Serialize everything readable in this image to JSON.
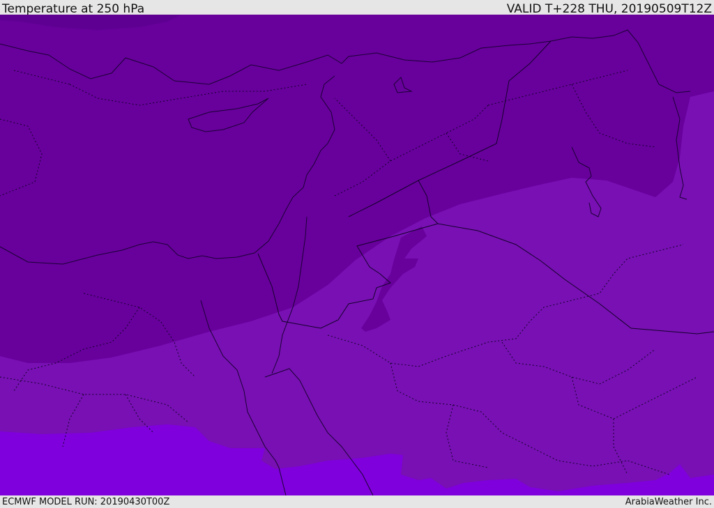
{
  "header": {
    "title": "Temperature at 250 hPa",
    "valid_time": "VALID T+228 THU, 20190509T12Z"
  },
  "footer": {
    "model_run": "ECMWF MODEL RUN: 20190430T00Z",
    "credit": "ArabiaWeather Inc."
  },
  "map": {
    "colors": {
      "coldest": "#5e0091",
      "cold": "#68009c",
      "mid": "#7810b3",
      "warm": "#7f00dc",
      "coast": "#1a0033",
      "border": "#14002a"
    }
  }
}
